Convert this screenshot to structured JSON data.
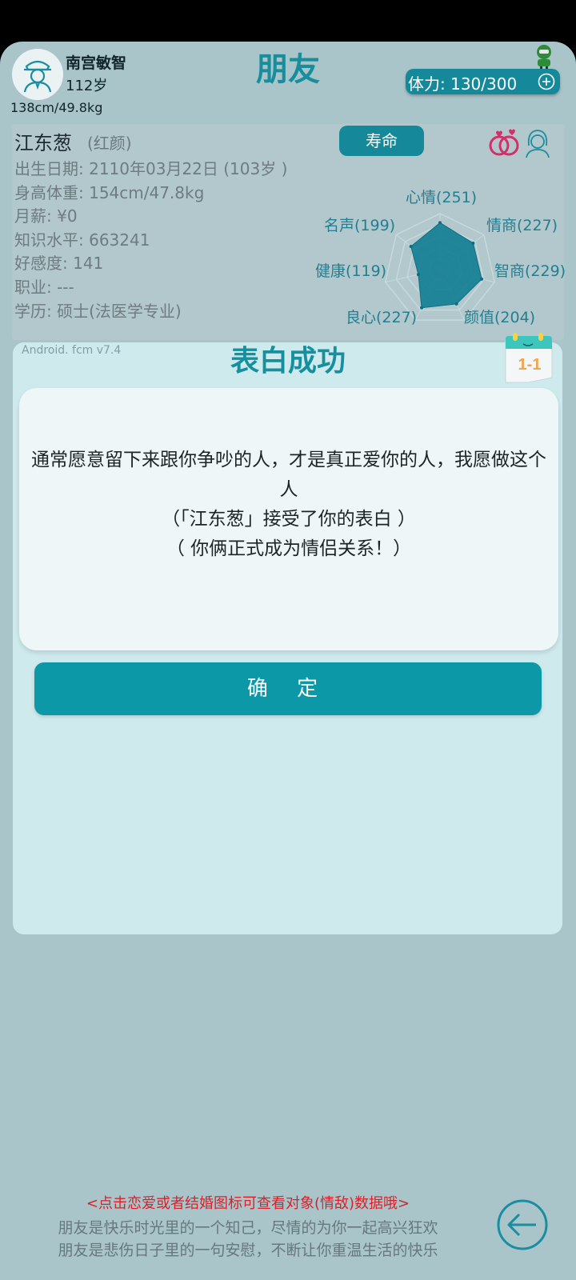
{
  "user": {
    "name": "南宫敏智",
    "age": "112岁",
    "size": "138cm/49.8kg"
  },
  "page": {
    "title": "朋友"
  },
  "stamina": {
    "text": "体力: 130/300"
  },
  "friend": {
    "name": "江东葱",
    "tag": "(红颜)",
    "life_button": "寿命",
    "info": [
      "出生日期: 2110年03月22日 (103岁 )",
      "身高体重: 154cm/47.8kg",
      "月薪: ¥0",
      "知识水平: 663241",
      "好感度: 141",
      "职业: ---",
      "学历: 硕士(法医学专业)"
    ],
    "radar": {
      "labels": [
        "心情(251)",
        "情商(227)",
        "智商(229)",
        "颜值(204)",
        "良心(227)",
        "健康(119)",
        "名声(199)"
      ],
      "values": [
        251,
        227,
        229,
        204,
        227,
        119,
        199
      ]
    }
  },
  "dialog": {
    "version": "Android. fcm v7.4",
    "title": "表白成功",
    "calendar_label": "1-1",
    "lines": [
      "通常愿意留下来跟你争吵的人，才是真正爱你的人，我愿做这个人",
      "（「江东葱」接受了你的表白 ）",
      "（ 你俩正式成为情侣关系！）"
    ],
    "confirm": "确 定"
  },
  "footer": {
    "hint": "<点击恋爱或者结婚图标可查看对象(情敌)数据哦>",
    "desc1": "朋友是快乐时光里的一个知己，尽情的为你一起高兴狂欢",
    "desc2": "朋友是悲伤日子里的一句安慰，不断让你重温生活的快乐"
  },
  "colors": {
    "accent": "#15899a",
    "title": "#1a8d9c",
    "hint": "#d7222a"
  },
  "icons": [
    "avatar-icon",
    "robot-icon",
    "plus-icon",
    "rings-icon",
    "girl-icon",
    "calendar-icon",
    "back-arrow-icon"
  ]
}
